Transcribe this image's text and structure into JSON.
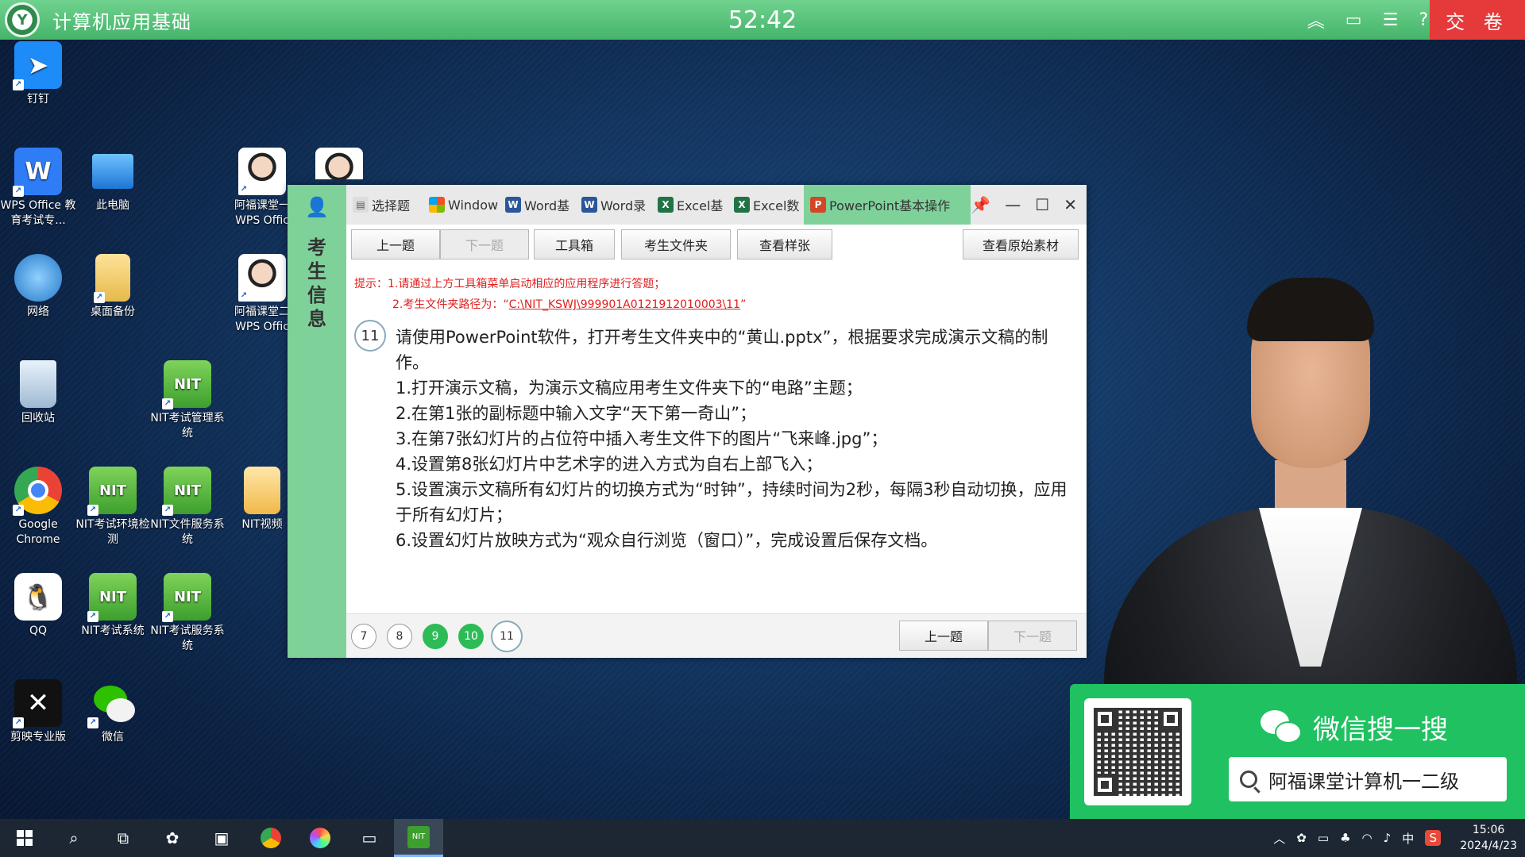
{
  "topbar": {
    "app_title": "计算机应用基础",
    "timer": "52:42",
    "submit_label": "交 卷"
  },
  "desktop": {
    "icons": [
      {
        "label": "钉钉"
      },
      {
        "label": "WPS Office 教育考试专..."
      },
      {
        "label": "此电脑"
      },
      {
        "label": "阿福课堂一 WPS Offic"
      },
      {
        "label": "网络"
      },
      {
        "label": "桌面备份"
      },
      {
        "label": "阿福课堂二 WPS Offic"
      },
      {
        "label": "回收站"
      },
      {
        "label": "NIT考试管理系统"
      },
      {
        "label": "Google Chrome"
      },
      {
        "label": "NIT考试环境检测"
      },
      {
        "label": "NIT文件服务系统"
      },
      {
        "label": "NIT视频"
      },
      {
        "label": "QQ"
      },
      {
        "label": "NIT考试系统"
      },
      {
        "label": "NIT考试服务系统"
      },
      {
        "label": "剪映专业版"
      },
      {
        "label": "微信"
      }
    ]
  },
  "exam": {
    "side_label": "考生信息",
    "tabs": [
      {
        "label": "选择题"
      },
      {
        "label": "Window"
      },
      {
        "label": "Word基"
      },
      {
        "label": "Word录"
      },
      {
        "label": "Excel基"
      },
      {
        "label": "Excel数"
      },
      {
        "label": "PowerPoint基本操作"
      }
    ],
    "toolbar": {
      "prev": "上一题",
      "next": "下一题",
      "toolbox": "工具箱",
      "student_folder": "考生文件夹",
      "view_sample": "查看样张",
      "view_original": "查看原始素材"
    },
    "hint": {
      "prefix": "提示：",
      "line1": "1.请通过上方工具箱菜单启动相应的应用程序进行答题；",
      "line2_prefix": "2.考生文件夹路径为：“",
      "path": "C:\\NIT_KSWJ\\999901A0121912010003\\11",
      "line2_suffix": "”"
    },
    "question": {
      "number": "11",
      "lines": [
        "请使用PowerPoint软件，打开考生文件夹中的“黄山.pptx”，根据要求完成演示文稿的制作。",
        "1.打开演示文稿，为演示文稿应用考生文件夹下的“电路”主题；",
        "2.在第1张的副标题中输入文字“天下第一奇山”；",
        "3.在第7张幻灯片的占位符中插入考生文件下的图片“飞来峰.jpg”；",
        "4.设置第8张幻灯片中艺术字的进入方式为自右上部飞入；",
        "5.设置演示文稿所有幻灯片的切换方式为“时钟”，持续时间为2秒，每隔3秒自动切换，应用于所有幻灯片；",
        "6.设置幻灯片放映方式为“观众自行浏览（窗口）”，完成设置后保存文档。"
      ]
    },
    "nav": {
      "dots": [
        "7",
        "8",
        "9",
        "10",
        "11"
      ],
      "prev": "上一题",
      "next": "下一题"
    }
  },
  "wechat": {
    "title": "微信搜一搜",
    "search_text": "阿福课堂计算机一二级"
  },
  "taskbar": {
    "tray_ime": "中",
    "time": "15:06",
    "date": "2024/4/23"
  },
  "colors": {
    "topbar_green": "#45b46a",
    "submit_red": "#e53a3a",
    "active_tab_green": "#7fd19a",
    "wechat_green": "#1fc161",
    "hint_red": "#e02020",
    "done_dot_green": "#2dbb58"
  }
}
